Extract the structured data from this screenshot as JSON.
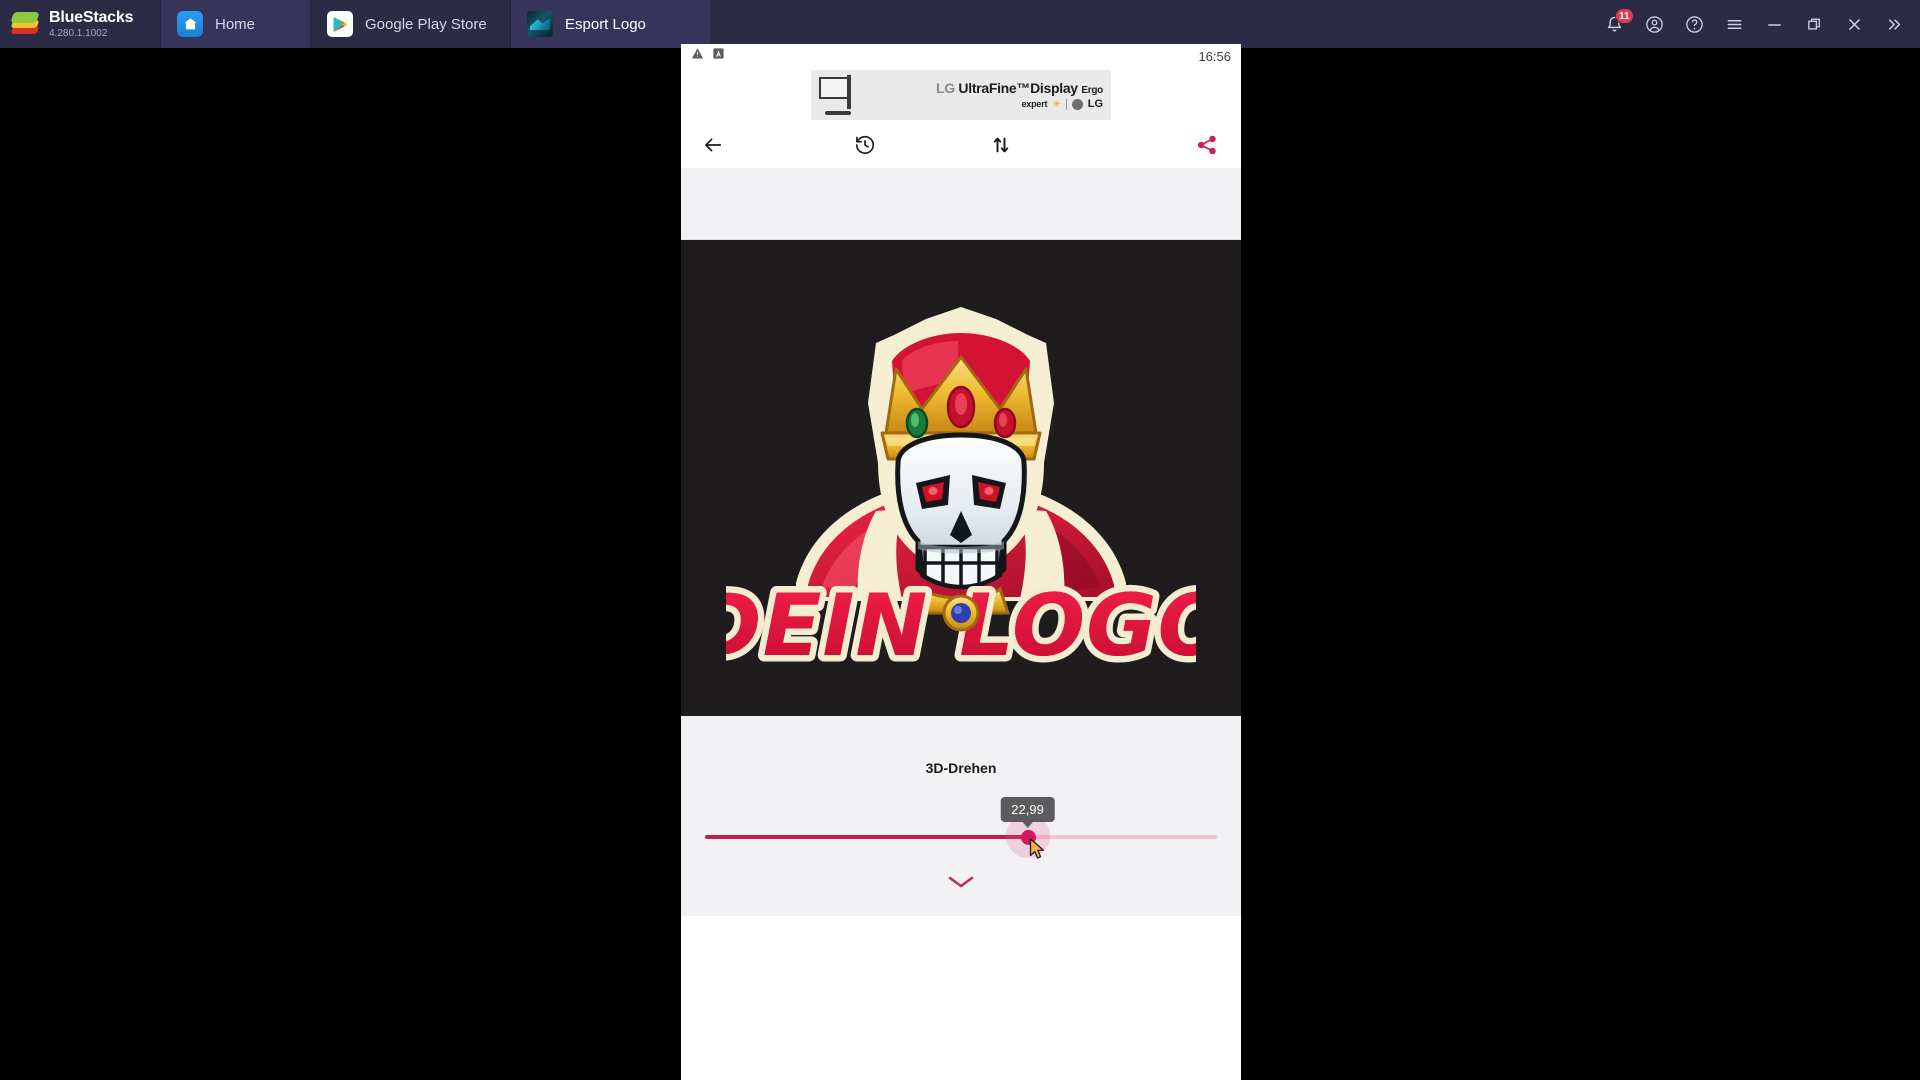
{
  "window": {
    "brand": "BlueStacks",
    "version": "4.280.1.1002",
    "brand_logo_icon": "bluestacks-stack-logo",
    "tabs": [
      {
        "id": "home",
        "label": "Home",
        "icon": "home-icon",
        "active": false
      },
      {
        "id": "play",
        "label": "Google Play Store",
        "icon": "google-play-icon",
        "active": false
      },
      {
        "id": "esport",
        "label": "Esport Logo",
        "icon": "esport-logo-icon",
        "active": true
      }
    ],
    "system_buttons": [
      {
        "id": "notifications",
        "icon": "bell-icon",
        "badge": "11",
        "title": "Notifications"
      },
      {
        "id": "account",
        "icon": "account-icon",
        "badge": "",
        "title": "Account"
      },
      {
        "id": "help",
        "icon": "help-icon",
        "badge": "",
        "title": "Help"
      },
      {
        "id": "menu",
        "icon": "hamburger-icon",
        "badge": "",
        "title": "Menu"
      },
      {
        "id": "minimize",
        "icon": "minimize-icon",
        "badge": "",
        "title": "Minimize"
      },
      {
        "id": "maximize",
        "icon": "maximize-icon",
        "badge": "",
        "title": "Maximize"
      },
      {
        "id": "close",
        "icon": "close-icon",
        "badge": "",
        "title": "Close"
      },
      {
        "id": "expand",
        "icon": "chevrons-right-icon",
        "badge": "",
        "title": "Expand"
      }
    ]
  },
  "android": {
    "statusbar": {
      "time": "16:56",
      "icons": [
        {
          "id": "warning",
          "icon": "warning-triangle-icon"
        },
        {
          "id": "app",
          "icon": "app-a-icon"
        }
      ]
    },
    "ad": {
      "brand": "LG",
      "product": "UltraFine™Display",
      "variant": "Ergo",
      "retailer": "expert",
      "retailer_mark": "✳",
      "advertiser": "LG",
      "image_icon": "monitor-arm-icon"
    },
    "app_toolbar": [
      {
        "id": "back",
        "icon": "arrow-left-icon",
        "color": "#1a1a1a"
      },
      {
        "id": "history",
        "icon": "history-clock-icon",
        "color": "#1a1a1a"
      },
      {
        "id": "swap",
        "icon": "arrows-up-down-icon",
        "color": "#1a1a1a"
      },
      {
        "id": "share",
        "icon": "share-icon",
        "color": "#c7235a"
      }
    ],
    "canvas": {
      "background": "#1e1c1c",
      "artwork_name": "skull-king-esport-logo",
      "wordmark": "DEIN LOGO",
      "wordmark_color": "#e4123c",
      "wordmark_outline": "#f3ecd0",
      "crown_gold": "#f0c13c",
      "cape_red": "#d81a3a",
      "skull_white": "#e9eef1",
      "eye_red": "#d01229"
    },
    "controls": {
      "slider_label": "3D-Drehen",
      "slider_value": "22,99",
      "slider_percent": 63,
      "slider_min": "0",
      "slider_max": "100",
      "accent_color": "#c71c4b",
      "track_color": "#f4c2d2",
      "collapse_icon": "chevron-down-icon",
      "cursor_icon": "mouse-cursor-icon"
    }
  }
}
